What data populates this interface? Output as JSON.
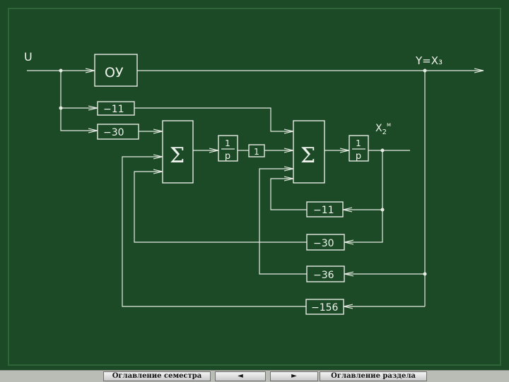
{
  "diagram": {
    "input_label": "U",
    "output_label": "Y=X₃",
    "plant_block": "ОУ",
    "gain_top_1": "−11",
    "gain_top_2": "−30",
    "summer_1": "Σ",
    "summer_2": "Σ",
    "integrator_1": {
      "num": "1",
      "den": "p"
    },
    "unit_gain": "1",
    "integrator_2": {
      "num": "1",
      "den": "p"
    },
    "state_label": "X",
    "state_subscript": "2",
    "state_superscript": "м",
    "feedback_gains": [
      "−11",
      "−30",
      "−36",
      "−156"
    ]
  },
  "nav": {
    "semester_toc": "Оглавление семестра",
    "prev_arrow": "◄",
    "next_arrow": "►",
    "section_toc": "Оглавление раздела"
  }
}
